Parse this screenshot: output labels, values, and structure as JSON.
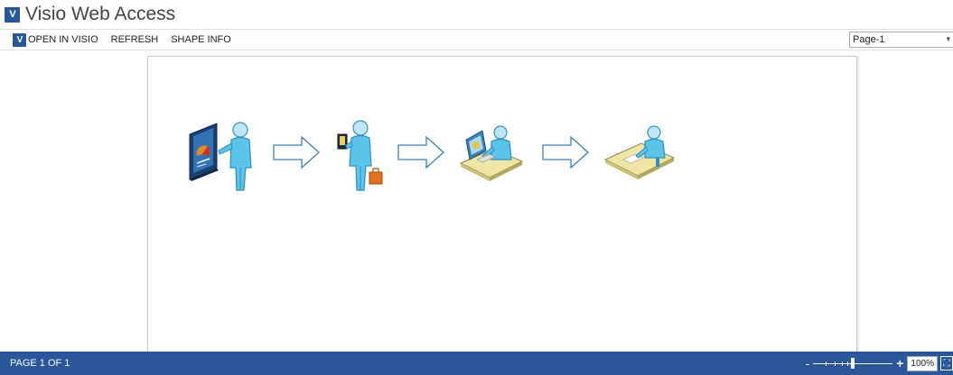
{
  "app": {
    "title": "Visio Web Access",
    "logo_text": "V"
  },
  "toolbar": {
    "open_label": "OPEN IN VISIO",
    "refresh_label": "REFRESH",
    "shape_info_label": "SHAPE INFO",
    "page_select_value": "Page-1"
  },
  "status": {
    "page_count": "PAGE 1 OF 1",
    "zoom_minus": "-",
    "zoom_plus": "+",
    "zoom_level": "100%"
  },
  "colors": {
    "brand": "#2b579a",
    "person": "#5bc4e8",
    "arrow": "#3a7fb0"
  },
  "diagram": {
    "shapes": [
      {
        "name": "presenter-with-board-icon",
        "kind": "presenter"
      },
      {
        "name": "arrow-right-icon",
        "kind": "arrow"
      },
      {
        "name": "person-with-briefcase-icon",
        "kind": "traveler"
      },
      {
        "name": "arrow-right-icon",
        "kind": "arrow"
      },
      {
        "name": "person-at-computer-desk-icon",
        "kind": "computer-desk"
      },
      {
        "name": "arrow-right-icon",
        "kind": "arrow"
      },
      {
        "name": "person-at-writing-desk-icon",
        "kind": "writing-desk"
      }
    ]
  }
}
